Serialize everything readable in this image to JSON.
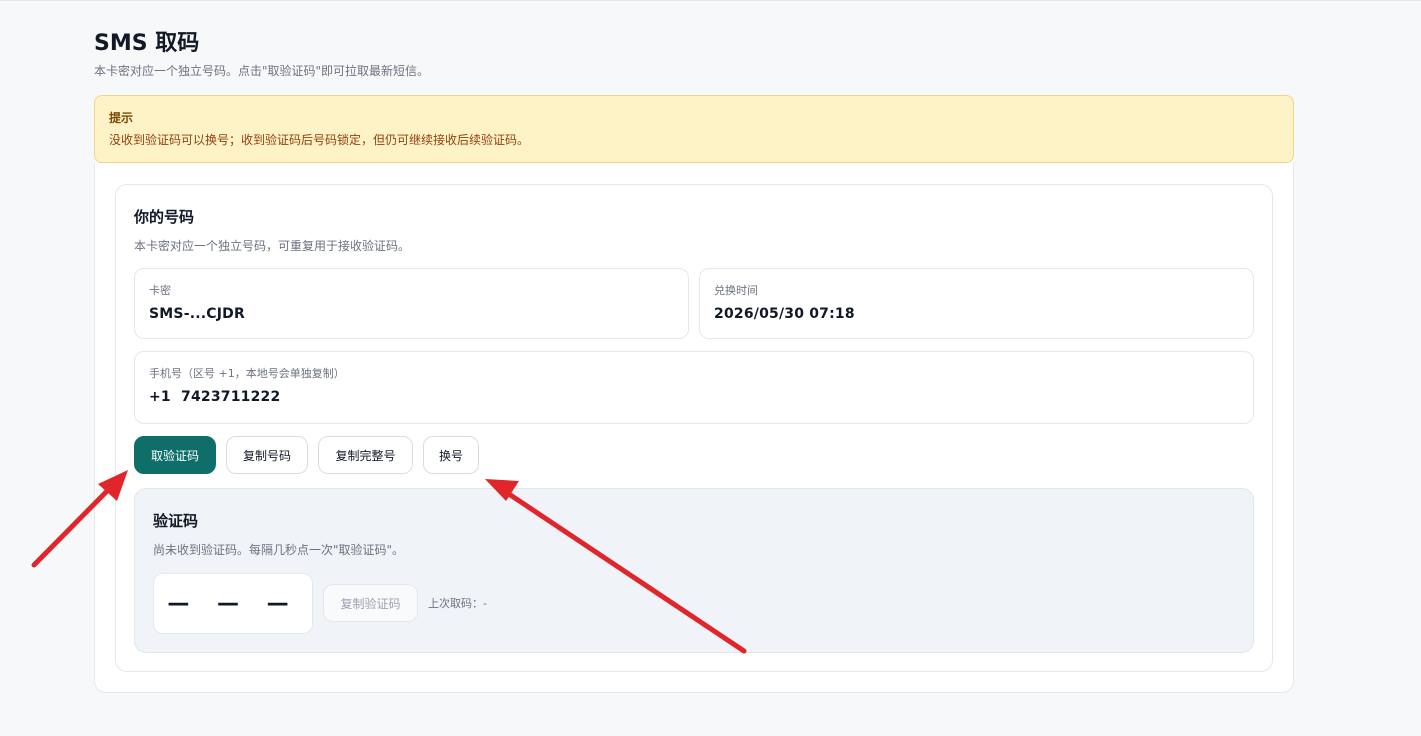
{
  "header": {
    "title": "SMS 取码",
    "subtitle": "本卡密对应一个独立号码。点击\"取验证码\"即可拉取最新短信。"
  },
  "notice": {
    "title": "提示",
    "text": "没收到验证码可以换号；收到验证码后号码锁定，但仍可继续接收后续验证码。"
  },
  "number_section": {
    "title": "你的号码",
    "description": "本卡密对应一个独立号码，可重复用于接收验证码。",
    "card_key": {
      "label": "卡密",
      "value": "SMS-...CJDR"
    },
    "redeem_time": {
      "label": "兑换时间",
      "value": "2026/05/30 07:18"
    },
    "phone": {
      "label": "手机号（区号 +1，本地号会单独复制）",
      "value": "+1  7423711222"
    }
  },
  "actions": {
    "get_code": "取验证码",
    "copy_number": "复制号码",
    "copy_full_number": "复制完整号",
    "change_number": "换号"
  },
  "code_section": {
    "title": "验证码",
    "description": "尚未收到验证码。每隔几秒点一次\"取验证码\"。",
    "code_placeholder": "— — —",
    "copy_code": "复制验证码",
    "last_fetch": "上次取码：-"
  },
  "colors": {
    "primary": "#0f6e6a",
    "notice_bg": "#fef3c7",
    "annotation_arrow": "#e0262b"
  },
  "annotations": {
    "arrow_icon": "red-arrow"
  }
}
